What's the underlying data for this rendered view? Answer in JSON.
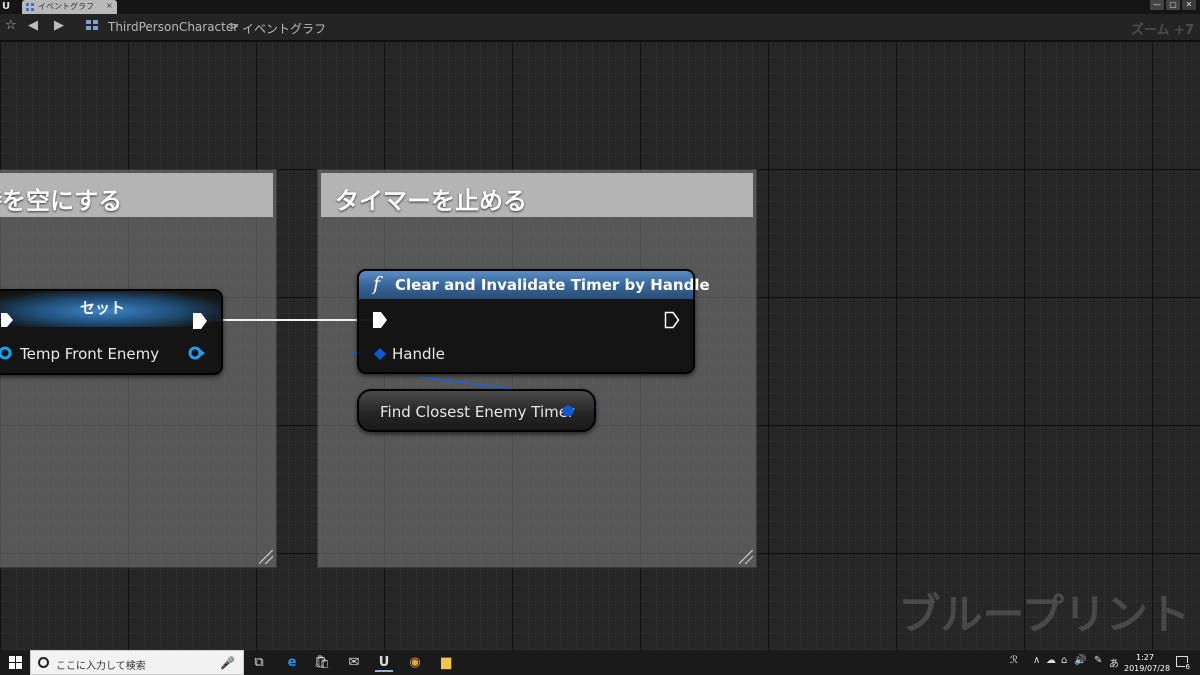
{
  "window": {
    "tab_label": "イベントグラフ",
    "tab_close": "×",
    "buttons": [
      "—",
      "▢",
      "✕"
    ]
  },
  "toolbar": {
    "breadcrumb_blueprint": "ThirdPersonCharacter",
    "breadcrumb_separator": ">",
    "breadcrumb_graph": "イベントグラフ",
    "zoom": "ズーム +7"
  },
  "graph": {
    "comment_left_title": "時を空にする",
    "comment_right_title": "タイマーを止める",
    "set_node": {
      "title": "セット",
      "pin_label": "Temp Front Enemy"
    },
    "function_node": {
      "icon": "f",
      "title": "Clear and Invalidate Timer by Handle",
      "pin_label": "Handle"
    },
    "variable_node": {
      "label": "Find Closest Enemy Timer"
    },
    "watermark": "ブループリント"
  },
  "taskbar": {
    "search_placeholder": "ここに入力して検索",
    "time": "1:27",
    "date": "2019/07/28",
    "notifications": "6"
  },
  "colors": {
    "exec_pin": "#ffffff",
    "object_pin": "#1aa0e8",
    "struct_pin": "#0b5cd4",
    "function_header": "#3a6a9f"
  }
}
